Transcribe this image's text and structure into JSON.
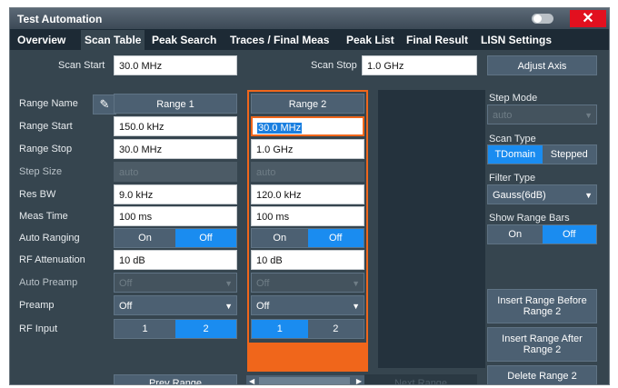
{
  "window": {
    "title": "Test Automation",
    "close": "✕"
  },
  "tabs": [
    "Overview",
    "Scan Table",
    "Peak Search",
    "Traces / Final Meas",
    "Peak List",
    "Final Result",
    "LISN Settings"
  ],
  "scan": {
    "start_label": "Scan Start",
    "start_value": "30.0 MHz",
    "stop_label": "Scan Stop",
    "stop_value": "1.0 GHz",
    "adjust_axis": "Adjust Axis"
  },
  "rows": {
    "range_name": "Range Name",
    "range_start": "Range Start",
    "range_stop": "Range Stop",
    "step_size": "Step Size",
    "res_bw": "Res BW",
    "meas_time": "Meas Time",
    "auto_ranging": "Auto Ranging",
    "rf_attenuation": "RF Attenuation",
    "auto_preamp": "Auto Preamp",
    "preamp": "Preamp",
    "rf_input": "RF Input"
  },
  "range1": {
    "name": "Range 1",
    "start": "150.0 kHz",
    "stop": "30.0 MHz",
    "step": "auto",
    "rbw": "9.0 kHz",
    "meas_time": "100 ms",
    "auto_on": "On",
    "auto_off": "Off",
    "atten": "10 dB",
    "auto_preamp": "Off",
    "preamp": "Off",
    "input_1": "1",
    "input_2": "2"
  },
  "range2": {
    "name": "Range 2",
    "start": "30.0 MHz",
    "stop": "1.0 GHz",
    "step": "auto",
    "rbw": "120.0 kHz",
    "meas_time": "100 ms",
    "auto_on": "On",
    "auto_off": "Off",
    "atten": "10 dB",
    "auto_preamp": "Off",
    "preamp": "Off",
    "input_1": "1",
    "input_2": "2"
  },
  "right": {
    "step_mode_label": "Step Mode",
    "step_mode_value": "auto",
    "scan_type_label": "Scan Type",
    "scan_type_a": "TDomain",
    "scan_type_b": "Stepped",
    "filter_type_label": "Filter Type",
    "filter_type_value": "Gauss(6dB)",
    "show_range_bars_label": "Show Range Bars",
    "bars_on": "On",
    "bars_off": "Off",
    "insert_before": "Insert Range Before Range 2",
    "insert_after": "Insert Range After Range 2",
    "delete": "Delete Range 2"
  },
  "bottom": {
    "prev_range": "Prev Range",
    "next_range": "Next Range"
  }
}
